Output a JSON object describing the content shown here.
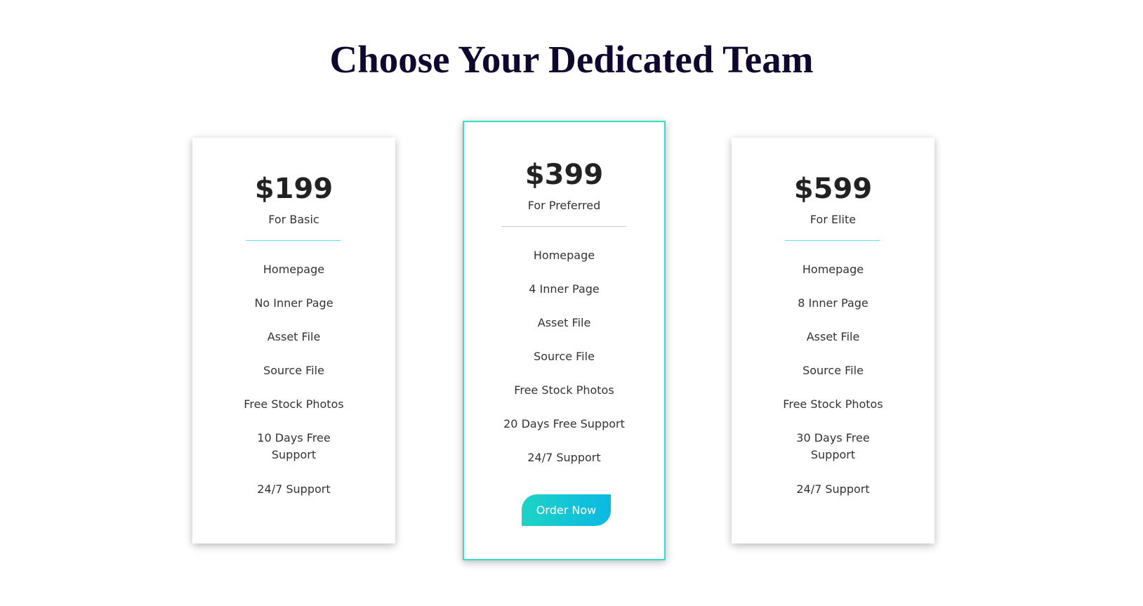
{
  "page": {
    "title": "Choose Your Dedicated Team"
  },
  "plans": [
    {
      "price": "$199",
      "name": "For Basic",
      "features": [
        "Homepage",
        "No Inner Page",
        "Asset File",
        "Source File",
        "Free Stock Photos",
        "10 Days Free Support",
        "24/7 Support"
      ],
      "highlighted": false
    },
    {
      "price": "$399",
      "name": "For Preferred",
      "features": [
        "Homepage",
        "4 Inner Page",
        "Asset File",
        "Source File",
        "Free Stock Photos",
        "20 Days Free Support",
        "24/7 Support"
      ],
      "button_label": "Order Now",
      "highlighted": true
    },
    {
      "price": "$599",
      "name": "For Elite",
      "features": [
        "Homepage",
        "8 Inner Page",
        "Asset File",
        "Source File",
        "Free Stock Photos",
        "30 Days Free Support",
        "24/7 Support"
      ],
      "highlighted": false
    }
  ],
  "colors": {
    "title": "#10072e",
    "accent_border": "#34ddc5",
    "divider_accent": "#5ee0f0",
    "divider_grey": "#cccccc",
    "button_gradient_start": "#1dd3c5",
    "button_gradient_end": "#0cb8e3",
    "text": "#333333",
    "price": "#222222"
  }
}
